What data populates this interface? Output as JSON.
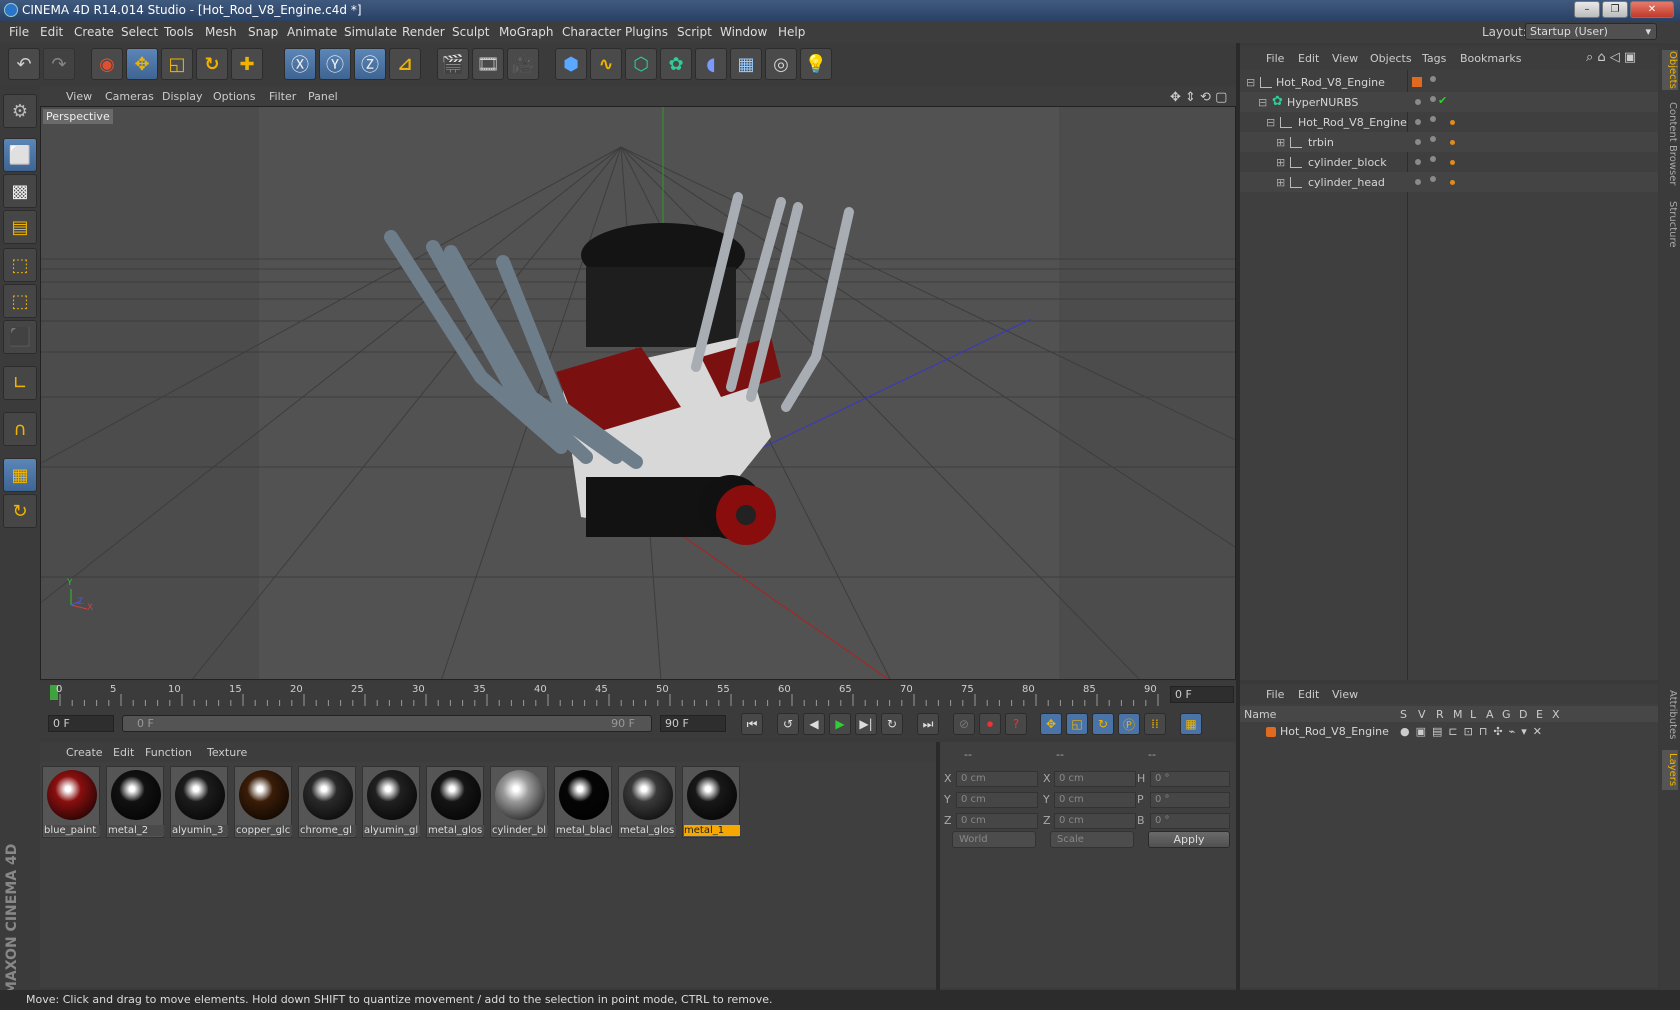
{
  "window": {
    "title": "CINEMA 4D R14.014 Studio - [Hot_Rod_V8_Engine.c4d *]",
    "min": "–",
    "max": "❐",
    "close": "✕"
  },
  "menu": [
    "File",
    "Edit",
    "Create",
    "Select",
    "Tools",
    "Mesh",
    "Snap",
    "Animate",
    "Simulate",
    "Render",
    "Sculpt",
    "MoGraph",
    "Character",
    "Plugins",
    "Script",
    "Window",
    "Help"
  ],
  "layout": {
    "label": "Layout:",
    "value": "Startup (User)"
  },
  "viewport": {
    "menu": [
      "View",
      "Cameras",
      "Display",
      "Options",
      "Filter",
      "Panel"
    ],
    "label": "Perspective",
    "axes": {
      "y": "Y",
      "x": "X",
      "z": "Z"
    }
  },
  "timeline": {
    "ticks": [
      "0",
      "5",
      "10",
      "15",
      "20",
      "25",
      "30",
      "35",
      "40",
      "45",
      "50",
      "55",
      "60",
      "65",
      "70",
      "75",
      "80",
      "85",
      "90"
    ],
    "frame_field": "0 F"
  },
  "transport": {
    "start": "0 F",
    "range_start": "0 F",
    "range_end": "90 F",
    "end": "90 F"
  },
  "materials": {
    "menu": [
      "Create",
      "Edit",
      "Function",
      "Texture"
    ],
    "items": [
      {
        "name": "blue_paint",
        "color": "#8a0f0f"
      },
      {
        "name": "metal_2",
        "color": "#111111"
      },
      {
        "name": "alyumin_3",
        "color": "#1c1c1c"
      },
      {
        "name": "copper_glc",
        "color": "#3a1d08"
      },
      {
        "name": "chrome_gl",
        "color": "#2a2a2a"
      },
      {
        "name": "alyumin_gl",
        "color": "#202020"
      },
      {
        "name": "metal_glos",
        "color": "#151515"
      },
      {
        "name": "cylinder_bl",
        "color": "#9a9a9a"
      },
      {
        "name": "metal_blacl",
        "color": "#050505"
      },
      {
        "name": "metal_glos",
        "color": "#3a3a3a"
      },
      {
        "name": "metal_1",
        "color": "#181818"
      }
    ],
    "selected": "metal_1"
  },
  "coords": {
    "headers": [
      "--",
      "--",
      "--"
    ],
    "rows": [
      {
        "a": "X",
        "av": "0 cm",
        "b": "X",
        "bv": "0 cm",
        "c": "H",
        "cv": "0 °"
      },
      {
        "a": "Y",
        "av": "0 cm",
        "b": "Y",
        "bv": "0 cm",
        "c": "P",
        "cv": "0 °"
      },
      {
        "a": "Z",
        "av": "0 cm",
        "b": "Z",
        "bv": "0 cm",
        "c": "B",
        "cv": "0 °"
      }
    ],
    "world": "World",
    "scale": "Scale",
    "apply": "Apply"
  },
  "objects": {
    "menu": [
      "File",
      "Edit",
      "View",
      "Objects",
      "Tags",
      "Bookmarks"
    ],
    "items": [
      {
        "name": "Hot_Rod_V8_Engine",
        "indent": 0
      },
      {
        "name": "HyperNURBS",
        "indent": 1
      },
      {
        "name": "Hot_Rod_V8_Engine",
        "indent": 2
      },
      {
        "name": "trbin",
        "indent": 3
      },
      {
        "name": "cylinder_block",
        "indent": 3
      },
      {
        "name": "cylinder_head",
        "indent": 3
      }
    ],
    "check": "✔"
  },
  "attributes": {
    "menu": [
      "File",
      "Edit",
      "View"
    ],
    "columns": [
      "Name",
      "S",
      "V",
      "R",
      "M",
      "L",
      "A",
      "G",
      "D",
      "E",
      "X"
    ],
    "row": "Hot_Rod_V8_Engine"
  },
  "right_tabs": [
    "Objects",
    "Content Browser",
    "Structure",
    "Attributes",
    "Layers"
  ],
  "brand": {
    "text": "MAXON CINEMA 4D"
  },
  "status": "Move: Click and drag to move elements. Hold down SHIFT to quantize movement / add to the selection in point mode, CTRL to remove.",
  "colors": {
    "accent": "#f6a800",
    "active_tool": "#4a74a8"
  }
}
